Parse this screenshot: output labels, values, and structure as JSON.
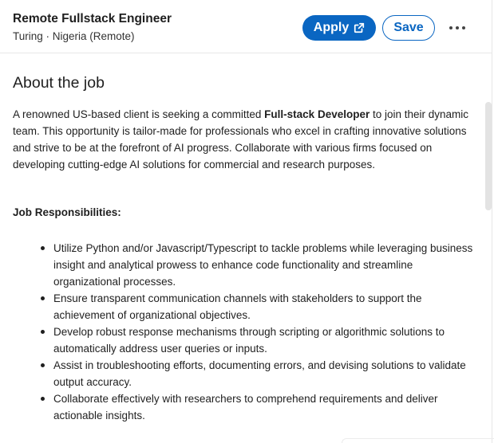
{
  "header": {
    "job_title": "Remote Fullstack Engineer",
    "company_location": "Turing · Nigeria (Remote)",
    "apply_label": "Apply",
    "apply_icon": "external-link-icon",
    "save_label": "Save",
    "more_icon": "more-horizontal-icon"
  },
  "about": {
    "title": "About the job",
    "intro_before": "A renowned US-based client is seeking a committed ",
    "intro_bold": "Full-stack Developer",
    "intro_after": " to join their dynamic team. This opportunity is tailor-made for professionals who excel in crafting innovative solutions and strive to be at the forefront of AI progress. Collaborate with various firms focused on developing cutting-edge AI solutions for commercial and research purposes.",
    "responsibilities_title": "Job Responsibilities:",
    "responsibilities": [
      "Utilize Python and/or Javascript/Typescript to tackle problems while leveraging business insight and analytical prowess to enhance code functionality and streamline organizational processes.",
      "Ensure transparent communication channels with stakeholders to support the achievement of organizational objectives.",
      "Develop robust response mechanisms through scripting or algorithmic solutions to automatically address user queries or inputs.",
      "Assist in troubleshooting efforts, documenting errors, and devising solutions to validate output accuracy.",
      "Collaborate effectively with researchers to comprehend requirements and deliver actionable insights."
    ]
  },
  "colors": {
    "primary": "#0a66c2",
    "text": "#1f1f1f"
  }
}
